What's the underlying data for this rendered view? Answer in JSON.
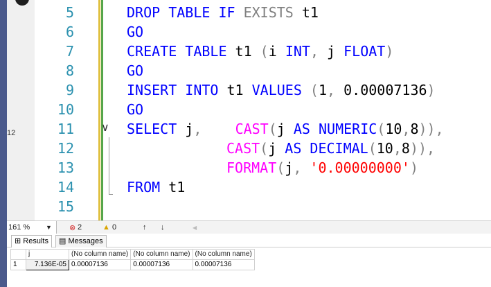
{
  "gutter_label": "12",
  "code_lines": [
    {
      "num": "5"
    },
    {
      "num": "6"
    },
    {
      "num": "7"
    },
    {
      "num": "8"
    },
    {
      "num": "9"
    },
    {
      "num": "10"
    },
    {
      "num": "11"
    },
    {
      "num": "12"
    },
    {
      "num": "13"
    },
    {
      "num": "14"
    },
    {
      "num": "15"
    }
  ],
  "code": {
    "l5": {
      "a": "DROP TABLE IF ",
      "b": "EXISTS",
      "c": " t1"
    },
    "l6": {
      "a": "GO"
    },
    "l7": {
      "a": "CREATE TABLE ",
      "b": "t1",
      "c": " (",
      "d": "i",
      "e": " INT",
      "f": ",",
      "g": " j",
      "h": " FLOAT",
      "i": ")"
    },
    "l8": {
      "a": "GO"
    },
    "l9": {
      "a": "INSERT INTO ",
      "b": "t1",
      "c": " VALUES",
      "d": " (",
      "e": "1",
      "f": ",",
      "g": " 0.00007136",
      "h": ")"
    },
    "l10": {
      "a": "GO"
    },
    "l11": {
      "a": "SELECT ",
      "b": "j",
      "c": ",",
      "d": "    ",
      "e": "CAST",
      "f": "(",
      "g": "j",
      "h": " AS",
      "i": " NUMERIC",
      "j": "(",
      "k": "10",
      "l": ",",
      "m": "8",
      "n": "))",
      "o": ","
    },
    "l12": {
      "e": "CAST",
      "f": "(",
      "g": "j",
      "h": " AS",
      "i": " DECIMAL",
      "j": "(",
      "k": "10",
      "l": ",",
      "m": "8",
      "n": "))",
      "o": ","
    },
    "l13": {
      "e": "FORMAT",
      "f": "(",
      "g": "j",
      "h": ",",
      "s": " '0.00000000'",
      "n": ")"
    },
    "l14": {
      "a": "FROM ",
      "b": "t1"
    }
  },
  "colors": {
    "keyword": "#0000ff",
    "function": "#ff00ff",
    "string": "#ff0000",
    "gray": "#808080",
    "linenum": "#2b91af",
    "changebar_yellow": "#e0c040",
    "changebar_green": "#57a64a"
  },
  "status": {
    "zoom": "161 %",
    "errors": "2",
    "warnings": "0",
    "up_icon": "arrow-up-icon",
    "down_icon": "arrow-down-icon"
  },
  "tabs": {
    "results": "Results",
    "messages": "Messages"
  },
  "grid": {
    "headers": [
      "j",
      "(No column name)",
      "(No column name)",
      "(No column name)"
    ],
    "rows": [
      {
        "rownum": "1",
        "cells": [
          "7.136E-05",
          "0.00007136",
          "0.00007136",
          "0.00007136"
        ]
      }
    ]
  }
}
